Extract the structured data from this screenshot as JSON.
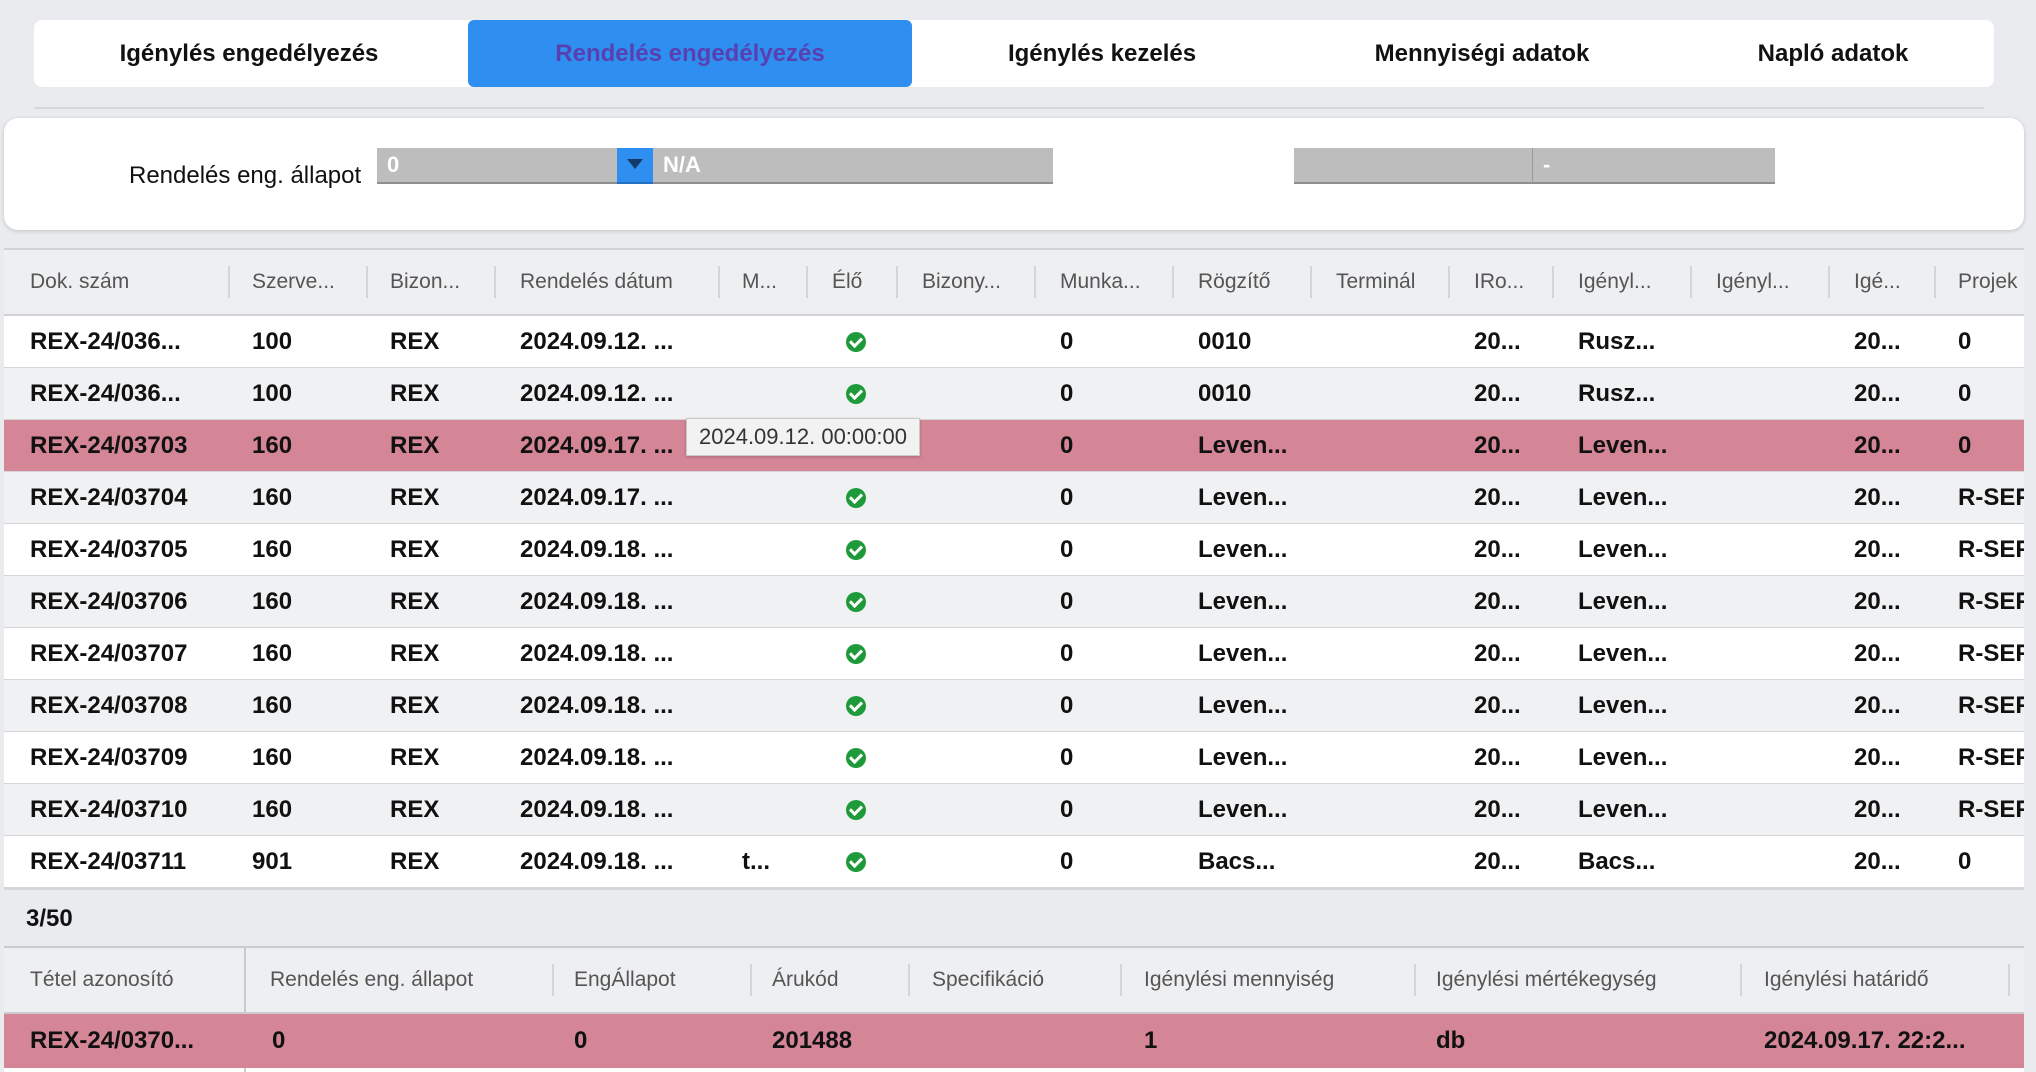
{
  "tabs": [
    {
      "label": "Igénylés engedélyezés",
      "active": false
    },
    {
      "label": "Rendelés engedélyezés",
      "active": true
    },
    {
      "label": "Igénylés kezelés",
      "active": false
    },
    {
      "label": "Mennyiségi adatok",
      "active": false
    },
    {
      "label": "Napló adatok",
      "active": false
    }
  ],
  "filter": {
    "label": "Rendelés eng. állapot",
    "code_value": "0",
    "text_value": "N/A",
    "second_value": "-"
  },
  "colors": {
    "accent": "#2f8ff0",
    "selected_row": "#d48596",
    "check": "#1f9a3a"
  },
  "grid": {
    "columns": [
      "Dok. szám",
      "Szerve...",
      "Bizon...",
      "Rendelés dátum",
      "M...",
      "Élő",
      "Bizony...",
      "Munka...",
      "Rögzítő",
      "Terminál",
      "IRo...",
      "Igényl...",
      "Igényl...",
      "Igé...",
      "Projek"
    ],
    "rows": [
      {
        "dok": "REX-24/036...",
        "szerv": "100",
        "bizon": "REX",
        "datum": "2024.09.12. ...",
        "m": "",
        "elo": true,
        "bizony": "",
        "munka": "0",
        "rogzito": "0010",
        "terminal": "",
        "iro": "20...",
        "igenyl1": "Rusz...",
        "igenyl2": "",
        "ige": "20...",
        "projek": "0",
        "selected": false
      },
      {
        "dok": "REX-24/036...",
        "szerv": "100",
        "bizon": "REX",
        "datum": "2024.09.12. ...",
        "m": "",
        "elo": true,
        "bizony": "",
        "munka": "0",
        "rogzito": "0010",
        "terminal": "",
        "iro": "20...",
        "igenyl1": "Rusz...",
        "igenyl2": "",
        "ige": "20...",
        "projek": "0",
        "selected": false
      },
      {
        "dok": "REX-24/03703",
        "szerv": "160",
        "bizon": "REX",
        "datum": "2024.09.17. ...",
        "m": "",
        "elo": true,
        "bizony": "",
        "munka": "0",
        "rogzito": "Leven...",
        "terminal": "",
        "iro": "20...",
        "igenyl1": "Leven...",
        "igenyl2": "",
        "ige": "20...",
        "projek": "0",
        "selected": true
      },
      {
        "dok": "REX-24/03704",
        "szerv": "160",
        "bizon": "REX",
        "datum": "2024.09.17. ...",
        "m": "",
        "elo": true,
        "bizony": "",
        "munka": "0",
        "rogzito": "Leven...",
        "terminal": "",
        "iro": "20...",
        "igenyl1": "Leven...",
        "igenyl2": "",
        "ige": "20...",
        "projek": "R-SEF",
        "selected": false
      },
      {
        "dok": "REX-24/03705",
        "szerv": "160",
        "bizon": "REX",
        "datum": "2024.09.18. ...",
        "m": "",
        "elo": true,
        "bizony": "",
        "munka": "0",
        "rogzito": "Leven...",
        "terminal": "",
        "iro": "20...",
        "igenyl1": "Leven...",
        "igenyl2": "",
        "ige": "20...",
        "projek": "R-SEF",
        "selected": false
      },
      {
        "dok": "REX-24/03706",
        "szerv": "160",
        "bizon": "REX",
        "datum": "2024.09.18. ...",
        "m": "",
        "elo": true,
        "bizony": "",
        "munka": "0",
        "rogzito": "Leven...",
        "terminal": "",
        "iro": "20...",
        "igenyl1": "Leven...",
        "igenyl2": "",
        "ige": "20...",
        "projek": "R-SEF",
        "selected": false
      },
      {
        "dok": "REX-24/03707",
        "szerv": "160",
        "bizon": "REX",
        "datum": "2024.09.18. ...",
        "m": "",
        "elo": true,
        "bizony": "",
        "munka": "0",
        "rogzito": "Leven...",
        "terminal": "",
        "iro": "20...",
        "igenyl1": "Leven...",
        "igenyl2": "",
        "ige": "20...",
        "projek": "R-SEF",
        "selected": false
      },
      {
        "dok": "REX-24/03708",
        "szerv": "160",
        "bizon": "REX",
        "datum": "2024.09.18. ...",
        "m": "",
        "elo": true,
        "bizony": "",
        "munka": "0",
        "rogzito": "Leven...",
        "terminal": "",
        "iro": "20...",
        "igenyl1": "Leven...",
        "igenyl2": "",
        "ige": "20...",
        "projek": "R-SEF",
        "selected": false
      },
      {
        "dok": "REX-24/03709",
        "szerv": "160",
        "bizon": "REX",
        "datum": "2024.09.18. ...",
        "m": "",
        "elo": true,
        "bizony": "",
        "munka": "0",
        "rogzito": "Leven...",
        "terminal": "",
        "iro": "20...",
        "igenyl1": "Leven...",
        "igenyl2": "",
        "ige": "20...",
        "projek": "R-SEF",
        "selected": false
      },
      {
        "dok": "REX-24/03710",
        "szerv": "160",
        "bizon": "REX",
        "datum": "2024.09.18. ...",
        "m": "",
        "elo": true,
        "bizony": "",
        "munka": "0",
        "rogzito": "Leven...",
        "terminal": "",
        "iro": "20...",
        "igenyl1": "Leven...",
        "igenyl2": "",
        "ige": "20...",
        "projek": "R-SEF",
        "selected": false
      },
      {
        "dok": "REX-24/03711",
        "szerv": "901",
        "bizon": "REX",
        "datum": "2024.09.18. ...",
        "m": "t...",
        "elo": true,
        "bizony": "",
        "munka": "0",
        "rogzito": "Bacs...",
        "terminal": "",
        "iro": "20...",
        "igenyl1": "Bacs...",
        "igenyl2": "",
        "ige": "20...",
        "projek": "0",
        "selected": false
      }
    ],
    "tooltip": "2024.09.12. 00:00:00",
    "count": "3/50"
  },
  "detail": {
    "columns": [
      "Tétel azonosító",
      "Rendelés eng. állapot",
      "EngÁllapot",
      "Árukód",
      "Specifikáció",
      "Igénylési mennyiség",
      "Igénylési mértékegység",
      "Igénylési határidő"
    ],
    "row": [
      "REX-24/0370...",
      "0",
      "0",
      "201488",
      "",
      "1",
      "db",
      "2024.09.17. 22:2..."
    ]
  }
}
